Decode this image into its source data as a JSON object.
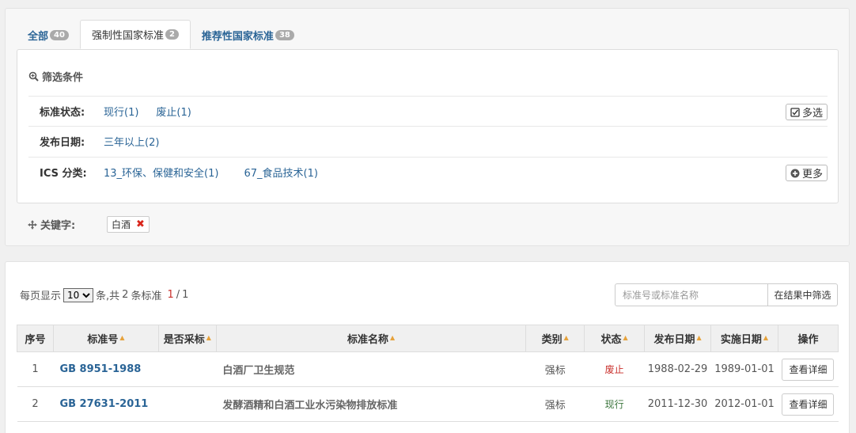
{
  "tabs": [
    {
      "label": "全部",
      "count": "40"
    },
    {
      "label": "强制性国家标准",
      "count": "2"
    },
    {
      "label": "推荐性国家标准",
      "count": "38"
    }
  ],
  "filter": {
    "title": "筛选条件",
    "status": {
      "label": "标准状态:",
      "options": [
        "现行(1)",
        "废止(1)"
      ],
      "button": "多选"
    },
    "date": {
      "label": "发布日期:",
      "options": [
        "三年以上(2)"
      ]
    },
    "ics": {
      "label": "ICS 分类:",
      "options": [
        "13_环保、保健和安全(1)",
        "67_食品技术(1)"
      ],
      "button": "更多"
    }
  },
  "keyword": {
    "label": "关键字:",
    "tag": "白酒",
    "remove_icon": "✖"
  },
  "pager": {
    "prefix": "每页显示",
    "page_size": "10",
    "suffix": "条,共",
    "total": "2",
    "unit": "条标准",
    "current": "1",
    "sep": "/",
    "pages": "1"
  },
  "search": {
    "placeholder": "标准号或标准名称",
    "button": "在结果中筛选"
  },
  "table": {
    "headers": [
      "序号",
      "标准号",
      "是否采标",
      "标准名称",
      "类别",
      "状态",
      "发布日期",
      "实施日期",
      "操作"
    ],
    "sort_icon": "▲",
    "rows": [
      {
        "idx": "1",
        "code": "GB 8951-1988",
        "adopt": "",
        "name": "白酒厂卫生规范",
        "type": "强标",
        "status": "废止",
        "publish": "1988-02-29",
        "effective": "1989-01-01",
        "action": "查看详细"
      },
      {
        "idx": "2",
        "code": "GB 27631-2011",
        "adopt": "",
        "name": "发酵酒精和白酒工业水污染物排放标准",
        "type": "强标",
        "status": "现行",
        "publish": "2011-12-30",
        "effective": "2012-01-01",
        "action": "查看详细"
      }
    ]
  },
  "colors": {
    "link": "#2a6496",
    "abolished": "#c9302c",
    "active": "#3c763d",
    "sort": "#e6a23c"
  }
}
